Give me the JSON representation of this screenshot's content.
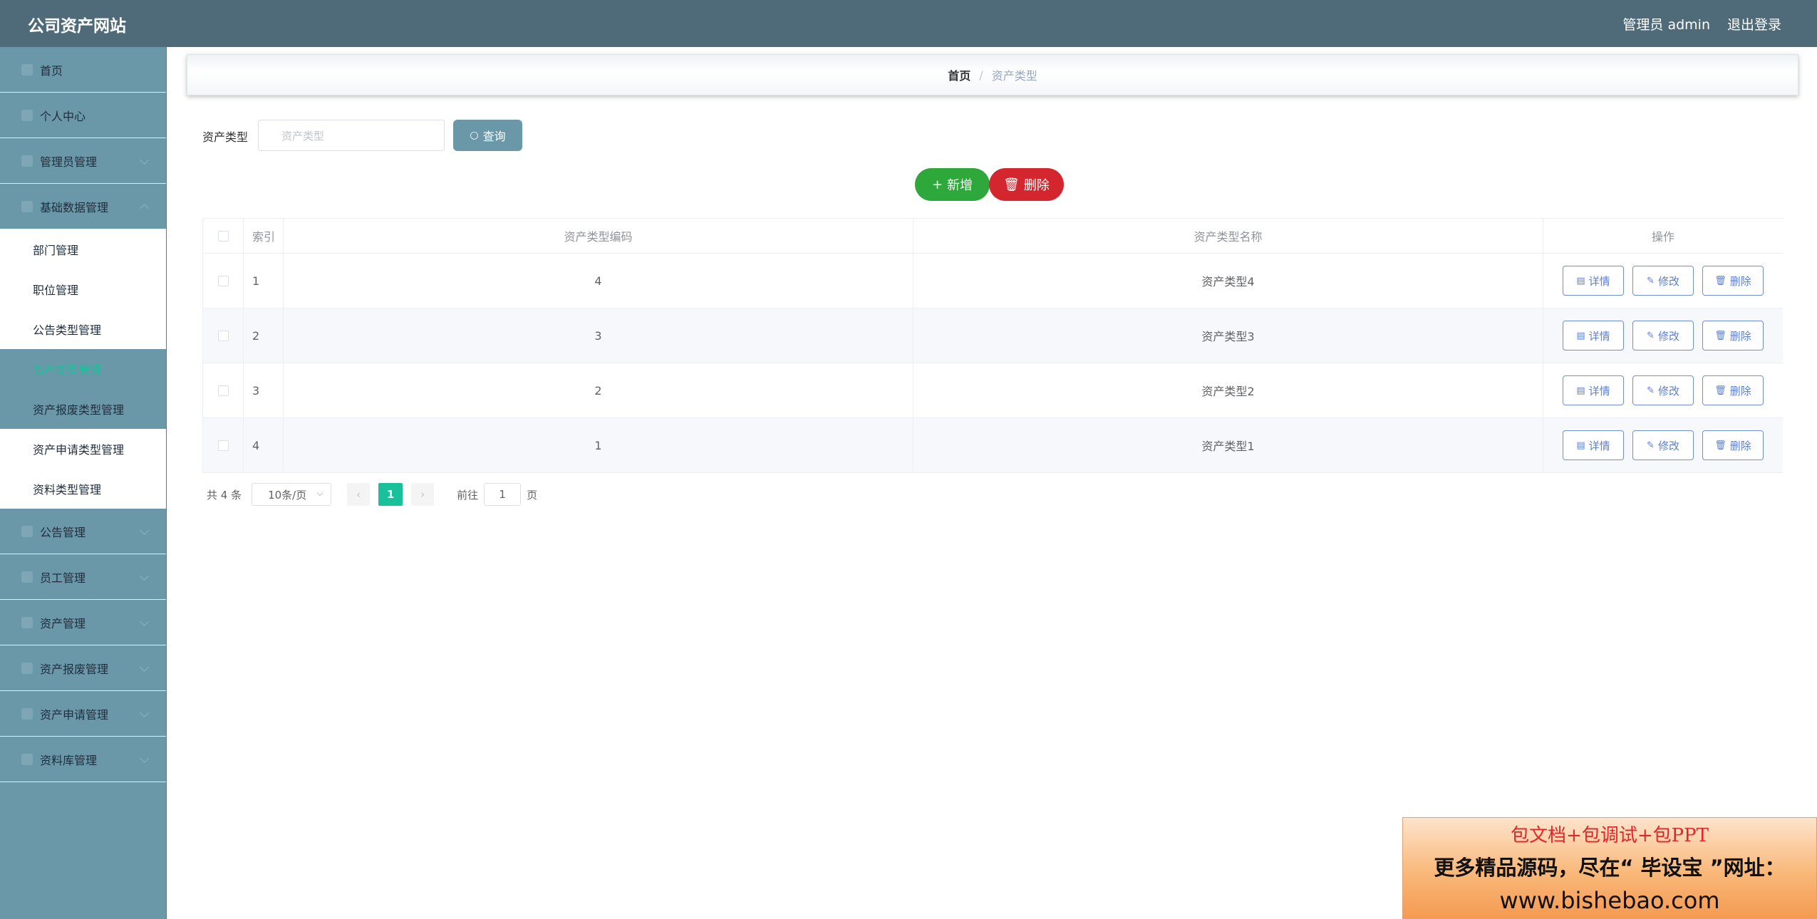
{
  "header": {
    "title": "公司资产网站",
    "user": "管理员 admin",
    "logout": "退出登录"
  },
  "sidebar": {
    "items_top": [
      "首页",
      "个人中心",
      "管理员管理",
      "基础数据管理"
    ],
    "submenu": [
      "部门管理",
      "职位管理",
      "公告类型管理",
      "资产类型管理",
      "资产报废类型管理",
      "资产申请类型管理",
      "资料类型管理"
    ],
    "items_bottom": [
      "公告管理",
      "员工管理",
      "资产管理",
      "资产报废管理",
      "资产申请管理",
      "资料库管理"
    ]
  },
  "breadcrumb": {
    "home": "首页",
    "separator": "/",
    "current": "资产类型"
  },
  "search": {
    "label": "资产类型",
    "placeholder": "资产类型",
    "button": "查询"
  },
  "actions": {
    "add": "新增",
    "delete": "删除"
  },
  "table": {
    "headers": {
      "index": "索引",
      "code": "资产类型编码",
      "name": "资产类型名称",
      "ops": "操作"
    },
    "rows": [
      {
        "index": "1",
        "code": "4",
        "name": "资产类型4"
      },
      {
        "index": "2",
        "code": "3",
        "name": "资产类型3"
      },
      {
        "index": "3",
        "code": "2",
        "name": "资产类型2"
      },
      {
        "index": "4",
        "code": "1",
        "name": "资产类型1"
      }
    ],
    "ops": {
      "detail": "详情",
      "edit": "修改",
      "delete": "删除"
    }
  },
  "pagination": {
    "total": "共 4 条",
    "page_size": "10条/页",
    "current": "1",
    "goto_prefix": "前往",
    "goto_value": "1",
    "goto_suffix": "页"
  },
  "banner": {
    "line1": "包文档+包调试+包PPT",
    "line2": "更多精品源码，尽在“ 毕设宝 ”网址：",
    "line3": "www.bishebao.com"
  },
  "colors": {
    "header_bg": "#4f6b79",
    "sidebar_bg": "#6b98a8",
    "accent": "#19c19a",
    "add": "#2ea83a",
    "delete": "#d4262e"
  }
}
